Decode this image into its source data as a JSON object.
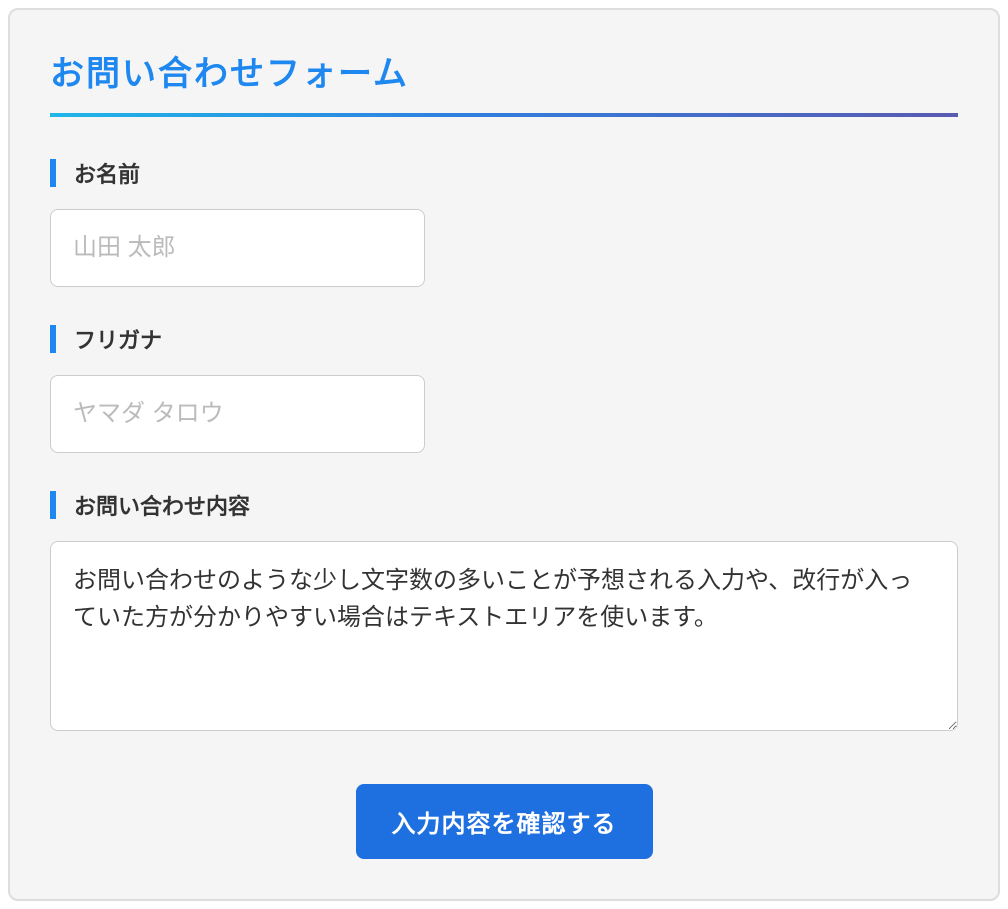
{
  "form": {
    "title": "お問い合わせフォーム",
    "fields": {
      "name": {
        "label": "お名前",
        "placeholder": "山田 太郎",
        "value": ""
      },
      "furigana": {
        "label": "フリガナ",
        "placeholder": "ヤマダ タロウ",
        "value": ""
      },
      "inquiry": {
        "label": "お問い合わせ内容",
        "value": "お問い合わせのような少し文字数の多いことが予想される入力や、改行が入っていた方が分かりやすい場合はテキストエリアを使います。"
      }
    },
    "submit_label": "入力内容を確認する"
  }
}
